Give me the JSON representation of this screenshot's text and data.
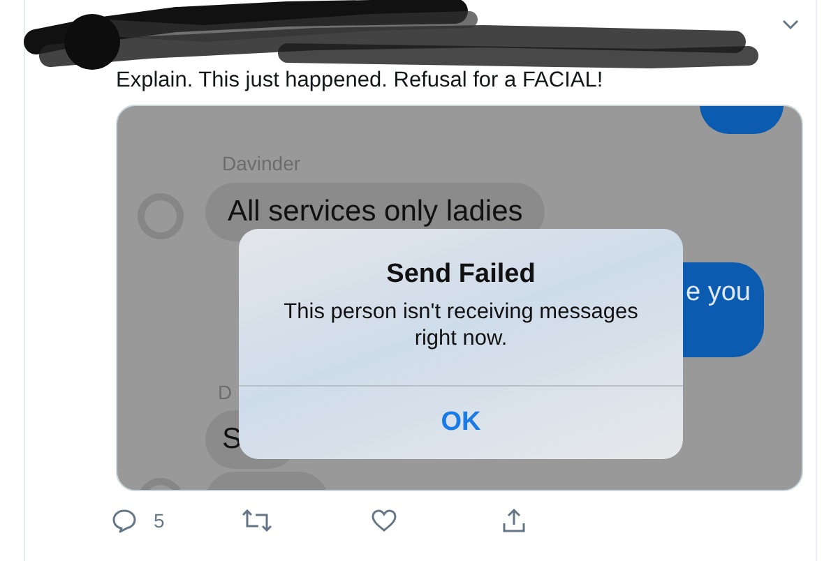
{
  "tweet": {
    "text": "Explain. This just happened. Refusal for a FACIAL!"
  },
  "screenshot": {
    "sender": "Davinder",
    "incoming_message": "All services only ladies",
    "outgoing_message": "e you",
    "second_sender": "D",
    "second_message": "S",
    "alert": {
      "title": "Send Failed",
      "message": "This person isn't receiving messages right now.",
      "button": "OK"
    }
  },
  "actions": [
    {
      "kind": "reply",
      "count": "5"
    },
    {
      "kind": "retweet"
    },
    {
      "kind": "like"
    },
    {
      "kind": "share"
    }
  ]
}
